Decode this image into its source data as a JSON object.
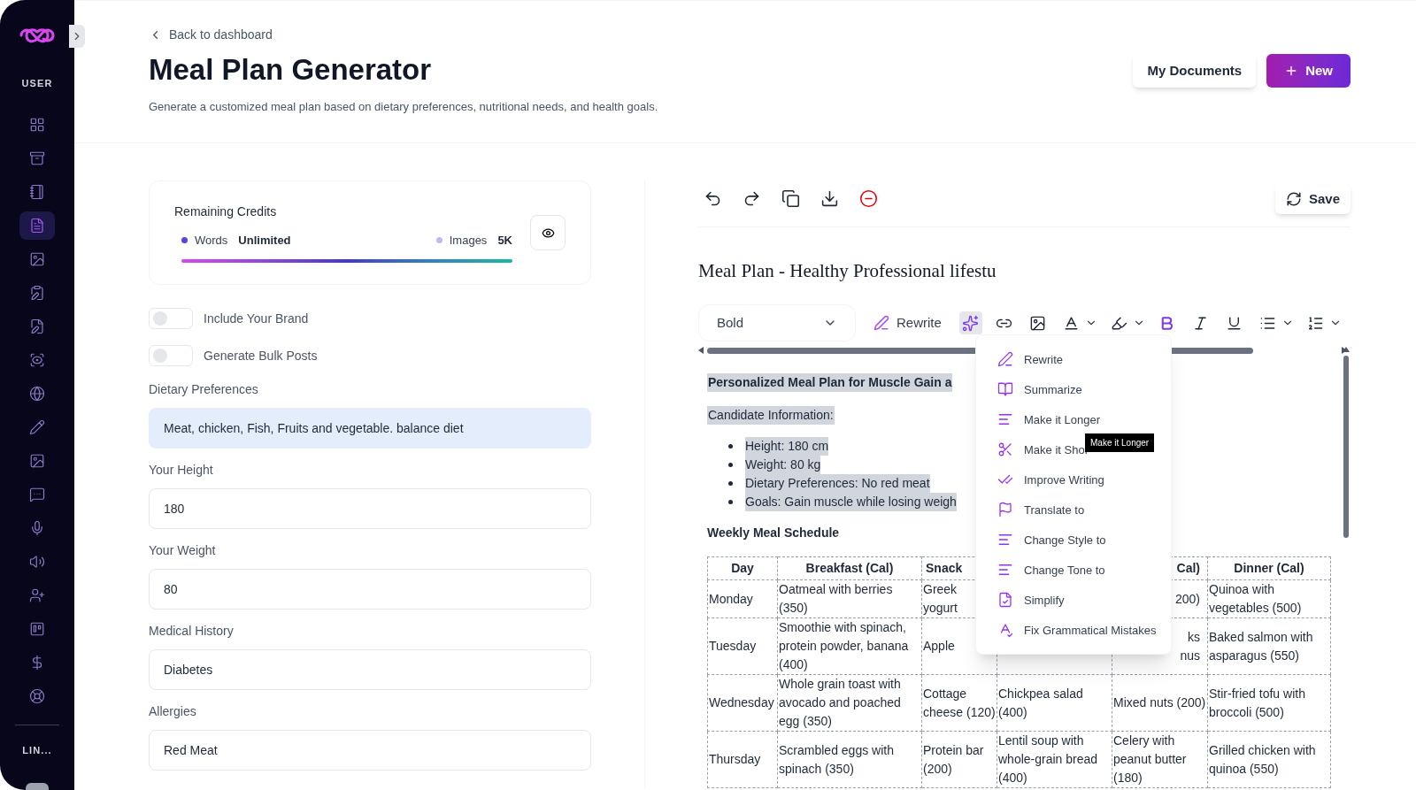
{
  "sidebar": {
    "section_label": "USER",
    "items": [
      {
        "selected": false
      },
      {
        "selected": false
      },
      {
        "selected": false
      },
      {
        "selected": true
      },
      {
        "selected": false
      },
      {
        "selected": false
      },
      {
        "selected": false
      },
      {
        "selected": false
      },
      {
        "selected": false
      },
      {
        "selected": false
      },
      {
        "selected": false
      },
      {
        "selected": false
      },
      {
        "selected": false
      },
      {
        "selected": false
      },
      {
        "selected": false
      },
      {
        "selected": false
      },
      {
        "selected": false
      },
      {
        "selected": false
      }
    ],
    "footer_label": "LIN..."
  },
  "header": {
    "back_link": "Back to dashboard",
    "title": "Meal Plan Generator",
    "subtitle": "Generate a customized meal plan based on dietary preferences, nutritional needs, and health goals.",
    "buttons": [
      {
        "label": "My Documents",
        "kind": "secondary"
      },
      {
        "label": "New",
        "kind": "primary"
      }
    ]
  },
  "credits": {
    "title": "Remaining Credits",
    "items": [
      {
        "label": "Words",
        "value": "Unlimited",
        "color": "#4f46e5"
      },
      {
        "label": "Images",
        "value": "5K",
        "color": "#c4b5fd"
      }
    ]
  },
  "toggles": [
    {
      "label": "Include Your Brand",
      "on": false
    },
    {
      "label": "Generate Bulk Posts",
      "on": false
    }
  ],
  "fields": [
    {
      "label": "Dietary Preferences",
      "value": "Meat, chicken, Fish, Fruits and vegetable. balance diet",
      "focused": true
    },
    {
      "label": "Your Height",
      "value": "180",
      "focused": false
    },
    {
      "label": "Your Weight",
      "value": "80",
      "focused": false
    },
    {
      "label": "Medical History",
      "value": "Diabetes",
      "focused": false
    },
    {
      "label": "Allergies",
      "value": "Red Meat",
      "focused": false
    }
  ],
  "editor": {
    "save_button": "Save",
    "document_title": "Meal Plan - Healthy Professional lifestu",
    "format_select": "Bold",
    "rewrite_button": "Rewrite",
    "format_tools": [
      {
        "selected": true
      },
      {
        "selected": false
      },
      {
        "selected": false
      },
      {
        "selected": false
      },
      {
        "selected": false
      },
      {
        "selected": true
      },
      {
        "selected": false
      },
      {
        "selected": false
      },
      {
        "selected": false
      },
      {
        "selected": false
      }
    ],
    "heading": "Personalized Meal Plan for Muscle Gain a",
    "info_label": "Candidate Information:",
    "bullets": [
      "Height: 180 cm",
      "Weight: 80 kg",
      "Dietary Preferences: No red meat",
      "Goals: Gain muscle while losing weigh"
    ],
    "schedule_title": "Weekly Meal Schedule",
    "table": {
      "columns": [
        "Day",
        "Breakfast (Cal)",
        "Snack",
        null,
        "Cal)",
        "Dinner (Cal)"
      ],
      "rows": [
        [
          "Monday",
          "Oatmeal with berries (350)",
          "Greek\nyogurt",
          null,
          "200)",
          "Quinoa with vegetables (500)"
        ],
        [
          "Tuesday",
          "Smoothie with spinach, protein powder, banana (400)",
          "Apple",
          null,
          "ks\nnus",
          "Baked salmon with asparagus (550)"
        ],
        [
          "Wednesday",
          "Whole grain toast with avocado and poached egg (350)",
          "Cottage cheese (120)",
          "Chickpea salad (400)",
          "Mixed nuts (200)",
          "Stir-fried tofu with broccoli (500)"
        ],
        [
          "Thursday",
          "Scrambled eggs with spinach (350)",
          "Protein bar (200)",
          "Lentil soup with whole-grain bread (400)",
          "Celery with peanut butter (180)",
          "Grilled chicken with quinoa (550)"
        ]
      ]
    },
    "ai_menu": {
      "items": [
        "Rewrite",
        "Summarize",
        "Make it Longer",
        "Make it Shor",
        "Improve Writing",
        "Translate to",
        "Change Style to",
        "Change Tone to",
        "Simplify",
        "Fix Grammatical Mistakes"
      ],
      "tooltip": "Make it Longer"
    }
  }
}
